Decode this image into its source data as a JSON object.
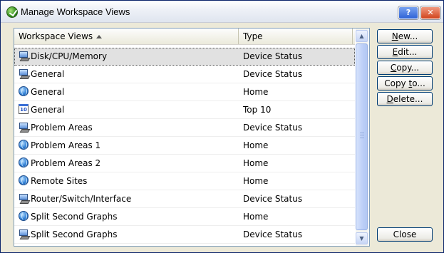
{
  "window": {
    "title": "Manage Workspace Views",
    "help_label": "?",
    "close_label": "✕"
  },
  "list": {
    "columns": [
      "Workspace Views",
      "Type"
    ],
    "sort_column": "Workspace Views",
    "rows": [
      {
        "name": "Disk/CPU/Memory",
        "type": "Device Status",
        "icon": "computer-icon",
        "selected": true
      },
      {
        "name": "General",
        "type": "Device Status",
        "icon": "computer-icon",
        "selected": false
      },
      {
        "name": "General",
        "type": "Home",
        "icon": "globe-icon",
        "selected": false
      },
      {
        "name": "General",
        "type": "Top 10",
        "icon": "top10-icon",
        "selected": false
      },
      {
        "name": "Problem Areas",
        "type": "Device Status",
        "icon": "computer-icon",
        "selected": false
      },
      {
        "name": "Problem Areas 1",
        "type": "Home",
        "icon": "globe-icon",
        "selected": false
      },
      {
        "name": "Problem Areas 2",
        "type": "Home",
        "icon": "globe-icon",
        "selected": false
      },
      {
        "name": "Remote Sites",
        "type": "Home",
        "icon": "globe-icon",
        "selected": false
      },
      {
        "name": "Router/Switch/Interface",
        "type": "Device Status",
        "icon": "computer-icon",
        "selected": false
      },
      {
        "name": "Split Second Graphs",
        "type": "Home",
        "icon": "globe-icon",
        "selected": false
      },
      {
        "name": "Split Second Graphs",
        "type": "Device Status",
        "icon": "computer-icon",
        "selected": false
      }
    ]
  },
  "buttons": {
    "new": {
      "underlined": "N",
      "rest": "ew..."
    },
    "edit": {
      "underlined": "E",
      "rest": "dit..."
    },
    "copy": {
      "underlined": "C",
      "rest": "opy..."
    },
    "copy_to": {
      "before": "Copy ",
      "underlined": "t",
      "rest": "o..."
    },
    "delete": {
      "underlined": "D",
      "rest": "elete..."
    },
    "close": "Close"
  },
  "colors": {
    "selection": "#e1e1e1",
    "border": "#7f9db9",
    "button_border": "#003c74"
  }
}
